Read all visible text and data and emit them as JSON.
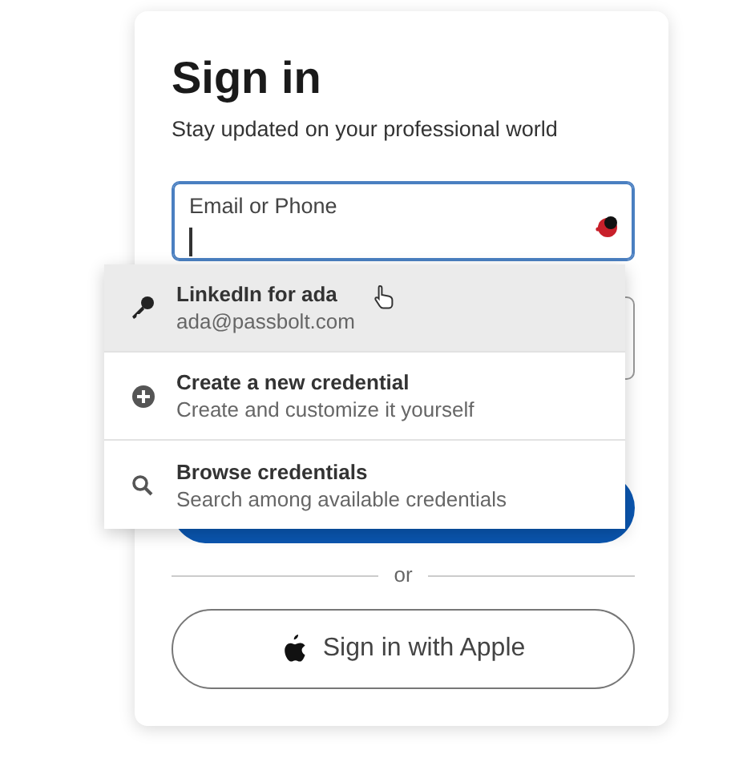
{
  "heading": "Sign in",
  "subheading": "Stay updated on your professional world",
  "email_field": {
    "label": "Email or Phone",
    "focused": true
  },
  "suggestions": [
    {
      "kind": "credential",
      "title": "LinkedIn for ada",
      "subtitle": "ada@passbolt.com",
      "selected": true
    },
    {
      "kind": "create",
      "title": "Create a new credential",
      "subtitle": "Create and customize it yourself",
      "selected": false
    },
    {
      "kind": "browse",
      "title": "Browse credentials",
      "subtitle": "Search among available credentials",
      "selected": false
    }
  ],
  "divider_text": "or",
  "apple_button": {
    "label": "Sign in with Apple"
  }
}
